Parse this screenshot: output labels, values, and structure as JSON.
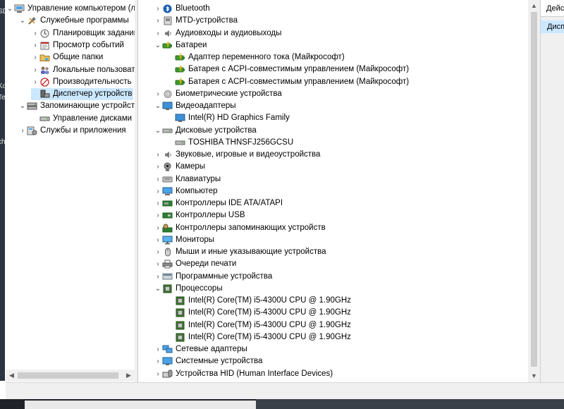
{
  "desktop_fragments": [
    "SD",
    "Ko",
    "Te",
    "ch"
  ],
  "left_tree": [
    {
      "label": "Управление компьютером (ло",
      "icon": "computer-management-icon",
      "level": 0,
      "expanded": true
    },
    {
      "label": "Служебные программы",
      "icon": "system-tools-icon",
      "level": 1,
      "expanded": true
    },
    {
      "label": "Планировщик заданий",
      "icon": "task-scheduler-icon",
      "level": 2,
      "expanded": false
    },
    {
      "label": "Просмотр событий",
      "icon": "event-viewer-icon",
      "level": 2,
      "expanded": false
    },
    {
      "label": "Общие папки",
      "icon": "shared-folders-icon",
      "level": 2,
      "expanded": false
    },
    {
      "label": "Локальные пользовате",
      "icon": "local-users-icon",
      "level": 2,
      "expanded": false
    },
    {
      "label": "Производительность",
      "icon": "performance-icon",
      "level": 2,
      "expanded": false
    },
    {
      "label": "Диспетчер устройств",
      "icon": "device-manager-icon",
      "level": 2,
      "selected": true
    },
    {
      "label": "Запоминающие устройств",
      "icon": "storage-icon",
      "level": 1,
      "expanded": true
    },
    {
      "label": "Управление дисками",
      "icon": "disk-management-icon",
      "level": 2
    },
    {
      "label": "Службы и приложения",
      "icon": "services-applications-icon",
      "level": 1,
      "expanded": false
    }
  ],
  "device_tree": [
    {
      "label": "Bluetooth",
      "icon": "bluetooth-icon",
      "level": 0,
      "expanded": false
    },
    {
      "label": "MTD-устройства",
      "icon": "mtd-device-icon",
      "level": 0,
      "expanded": false
    },
    {
      "label": "Аудиовходы и аудиовыходы",
      "icon": "audio-icon",
      "level": 0,
      "expanded": false
    },
    {
      "label": "Батареи",
      "icon": "battery-icon",
      "level": 0,
      "expanded": true
    },
    {
      "label": "Адаптер переменного тока (Майкрософт)",
      "icon": "battery-icon",
      "level": 1
    },
    {
      "label": "Батарея с ACPI-совместимым управлением (Майкрософт)",
      "icon": "battery-icon",
      "level": 1
    },
    {
      "label": "Батарея с ACPI-совместимым управлением (Майкрософт)",
      "icon": "battery-icon",
      "level": 1
    },
    {
      "label": "Биометрические устройства",
      "icon": "biometric-icon",
      "level": 0,
      "expanded": false
    },
    {
      "label": "Видеоадаптеры",
      "icon": "display-adapter-icon",
      "level": 0,
      "expanded": true
    },
    {
      "label": "Intel(R) HD Graphics Family",
      "icon": "display-adapter-icon",
      "level": 1
    },
    {
      "label": "Дисковые устройства",
      "icon": "disk-drive-icon",
      "level": 0,
      "expanded": true
    },
    {
      "label": "TOSHIBA THNSFJ256GCSU",
      "icon": "disk-drive-icon",
      "level": 1
    },
    {
      "label": "Звуковые, игровые и видеоустройства",
      "icon": "audio-icon",
      "level": 0,
      "expanded": false
    },
    {
      "label": "Камеры",
      "icon": "camera-icon",
      "level": 0,
      "expanded": false
    },
    {
      "label": "Клавиатуры",
      "icon": "keyboard-icon",
      "level": 0,
      "expanded": false
    },
    {
      "label": "Компьютер",
      "icon": "computer-icon",
      "level": 0,
      "expanded": false
    },
    {
      "label": "Контроллеры IDE ATA/ATAPI",
      "icon": "ide-controller-icon",
      "level": 0,
      "expanded": false
    },
    {
      "label": "Контроллеры USB",
      "icon": "usb-controller-icon",
      "level": 0,
      "expanded": false
    },
    {
      "label": "Контроллеры запоминающих устройств",
      "icon": "storage-controller-icon",
      "level": 0,
      "expanded": false
    },
    {
      "label": "Мониторы",
      "icon": "monitor-icon",
      "level": 0,
      "expanded": false
    },
    {
      "label": "Мыши и иные указывающие устройства",
      "icon": "mouse-icon",
      "level": 0,
      "expanded": false
    },
    {
      "label": "Очереди печати",
      "icon": "printer-icon",
      "level": 0,
      "expanded": false
    },
    {
      "label": "Программные устройства",
      "icon": "software-device-icon",
      "level": 0,
      "expanded": false
    },
    {
      "label": "Процессоры",
      "icon": "processor-icon",
      "level": 0,
      "expanded": true
    },
    {
      "label": "Intel(R) Core(TM) i5-4300U CPU @ 1.90GHz",
      "icon": "processor-icon",
      "level": 1
    },
    {
      "label": "Intel(R) Core(TM) i5-4300U CPU @ 1.90GHz",
      "icon": "processor-icon",
      "level": 1
    },
    {
      "label": "Intel(R) Core(TM) i5-4300U CPU @ 1.90GHz",
      "icon": "processor-icon",
      "level": 1
    },
    {
      "label": "Intel(R) Core(TM) i5-4300U CPU @ 1.90GHz",
      "icon": "processor-icon",
      "level": 1
    },
    {
      "label": "Сетевые адаптеры",
      "icon": "network-adapter-icon",
      "level": 0,
      "expanded": false
    },
    {
      "label": "Системные устройства",
      "icon": "system-device-icon",
      "level": 0,
      "expanded": false
    },
    {
      "label": "Устройства HID (Human Interface Devices)",
      "icon": "hid-icon",
      "level": 0,
      "expanded": false
    }
  ],
  "actions_panel": {
    "header": "Дейс",
    "selected": "Дисп"
  },
  "colors": {
    "selection": "#cce8ff",
    "panel": "#f0f0f0",
    "bluetooth": "#1a5fb4",
    "battery": "#3c9a2f"
  }
}
